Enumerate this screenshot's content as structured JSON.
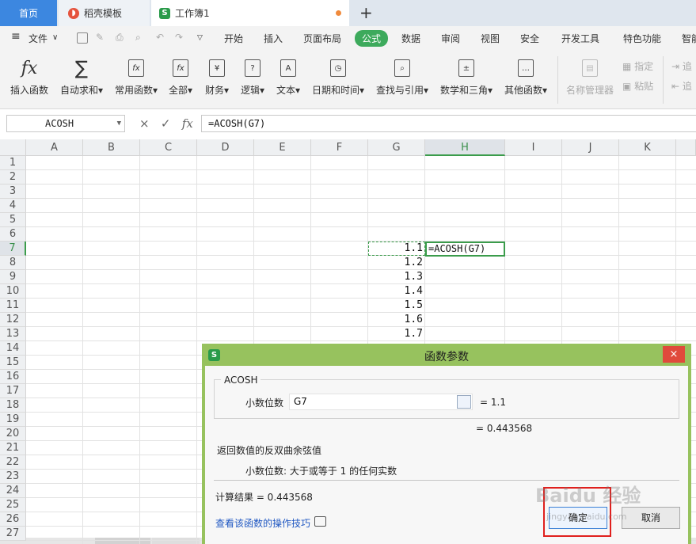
{
  "tabs": {
    "home": "首页",
    "docer": "稻壳模板",
    "workbook": "工作簿1"
  },
  "menu": [
    "文件",
    "开始",
    "插入",
    "页面布局",
    "公式",
    "数据",
    "审阅",
    "视图",
    "安全",
    "开发工具",
    "特色功能",
    "智能"
  ],
  "ribbon": [
    {
      "label": "插入函数",
      "glyph": "fx"
    },
    {
      "label": "自动求和",
      "glyph": "∑"
    },
    {
      "label": "常用函数",
      "glyph": "fx"
    },
    {
      "label": "全部",
      "glyph": "fx"
    },
    {
      "label": "财务",
      "glyph": "¥"
    },
    {
      "label": "逻辑",
      "glyph": "?"
    },
    {
      "label": "文本",
      "glyph": "A"
    },
    {
      "label": "日期和时间",
      "glyph": "◷"
    },
    {
      "label": "查找与引用",
      "glyph": "⌕"
    },
    {
      "label": "数学和三角",
      "glyph": "±"
    },
    {
      "label": "其他函数",
      "glyph": "…"
    },
    {
      "label": "名称管理器",
      "glyph": "▤"
    },
    {
      "label": "指定",
      "glyph": "▦"
    },
    {
      "label": "粘贴",
      "glyph": "▣"
    },
    {
      "label": "追",
      "glyph": "⇥"
    },
    {
      "label": "追",
      "glyph": "⇤"
    }
  ],
  "formula_bar": {
    "name_box": "ACOSH",
    "formula": "=ACOSH(G7)",
    "cancel": "×",
    "confirm": "✓",
    "fx": "fx"
  },
  "grid": {
    "columns": [
      "A",
      "B",
      "C",
      "D",
      "E",
      "F",
      "G",
      "H",
      "I",
      "J",
      "K"
    ],
    "rows": [
      "1",
      "2",
      "3",
      "4",
      "5",
      "6",
      "7",
      "8",
      "9",
      "10",
      "11",
      "12",
      "13",
      "14",
      "15",
      "16",
      "17",
      "18",
      "19",
      "20",
      "21",
      "22",
      "23",
      "24",
      "25",
      "26",
      "27"
    ],
    "g_values": [
      "1.1",
      "1.2",
      "1.3",
      "1.4",
      "1.5",
      "1.6",
      "1.7"
    ],
    "active_cell_text": "=ACOSH(G7)"
  },
  "dialog": {
    "title": "函数参数",
    "close": "×",
    "function_name": "ACOSH",
    "arg_label": "小数位数",
    "arg_value": "G7",
    "arg_result": "=  1.1",
    "fn_result": "=  0.443568",
    "description": "返回数值的反双曲余弦值",
    "param_desc": "小数位数:  大于或等于 1 的任何实数",
    "calc_result": "计算结果  =  0.443568",
    "help_link": "查看该函数的操作技巧",
    "ok": "确定",
    "cancel": "取消"
  },
  "watermark": {
    "main": "Baidu 经验",
    "sub": "jingyan.baidu.com"
  },
  "colors": {
    "accent_green": "#3b9c4b",
    "dialog_frame": "#97c25e",
    "close_red": "#e04a3c",
    "tab_blue": "#3c87e0",
    "highlight_red": "#e0201d"
  }
}
